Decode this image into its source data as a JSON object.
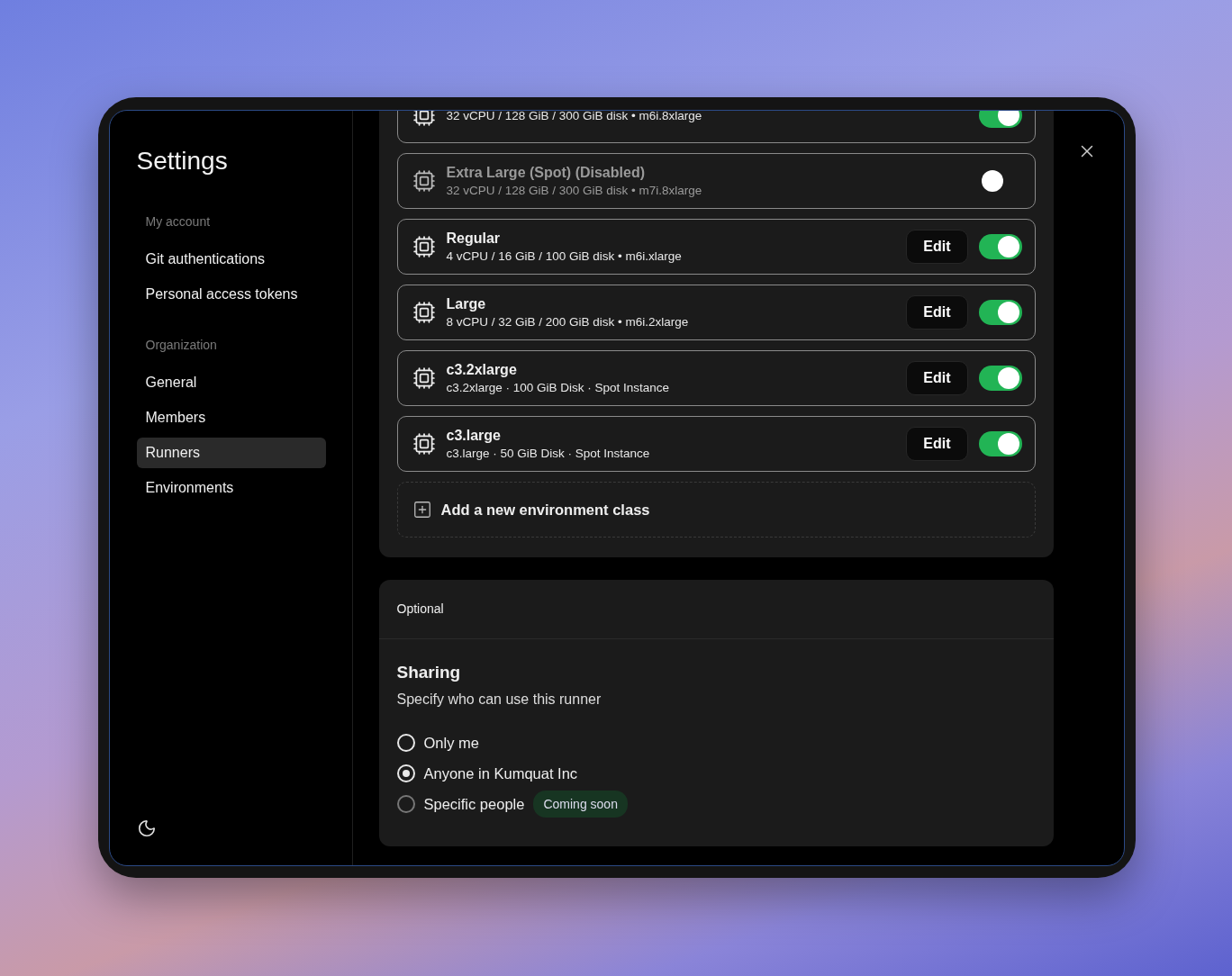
{
  "sidebar": {
    "title": "Settings",
    "groups": [
      {
        "heading": "My account",
        "items": [
          {
            "label": "Git authentications",
            "selected": false
          },
          {
            "label": "Personal access tokens",
            "selected": false
          }
        ]
      },
      {
        "heading": "Organization",
        "items": [
          {
            "label": "General",
            "selected": false
          },
          {
            "label": "Members",
            "selected": false
          },
          {
            "label": "Runners",
            "selected": true
          },
          {
            "label": "Environments",
            "selected": false
          }
        ]
      }
    ]
  },
  "environment_classes": [
    {
      "specs": "32 vCPU / 128 GiB / 300 GiB disk • m6i.8xlarge",
      "enabled": true,
      "disabled": false
    },
    {
      "name": "Extra Large (Spot) (Disabled)",
      "specs": "32 vCPU / 128 GiB / 300 GiB disk • m7i.8xlarge",
      "enabled": false,
      "disabled": true
    },
    {
      "name": "Regular",
      "specs": "4 vCPU / 16 GiB / 100 GiB disk • m6i.xlarge",
      "edit_label": "Edit",
      "enabled": true,
      "disabled": false
    },
    {
      "name": "Large",
      "specs": "8 vCPU / 32 GiB / 200 GiB disk • m6i.2xlarge",
      "edit_label": "Edit",
      "enabled": true,
      "disabled": false
    },
    {
      "name": "c3.2xlarge",
      "specs": "c3.2xlarge · 100 GiB Disk · Spot Instance",
      "edit_label": "Edit",
      "enabled": true,
      "disabled": false
    },
    {
      "name": "c3.large",
      "specs": "c3.large · 50 GiB Disk · Spot Instance",
      "edit_label": "Edit",
      "enabled": true,
      "disabled": false
    }
  ],
  "add_class_label": "Add a new environment class",
  "optional": {
    "header": "Optional",
    "title": "Sharing",
    "description": "Specify who can use this runner",
    "options": [
      {
        "label": "Only me",
        "selected": false,
        "disabled": false
      },
      {
        "label": "Anyone in Kumquat Inc",
        "selected": true,
        "disabled": false
      },
      {
        "label": "Specific people",
        "selected": false,
        "disabled": true,
        "badge": "Coming soon"
      }
    ]
  }
}
